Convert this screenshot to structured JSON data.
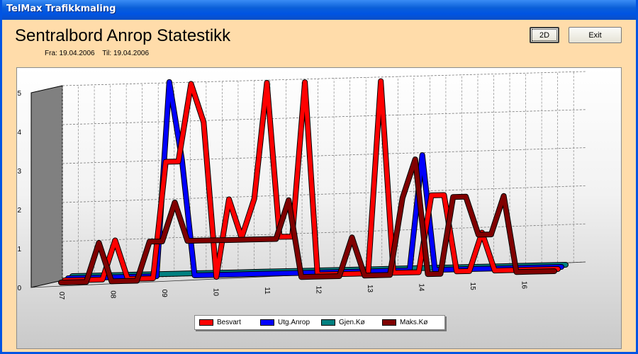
{
  "window": {
    "title": "TelMax Trafikkmaling"
  },
  "header": {
    "title": "Sentralbord Anrop Statestikk",
    "from_label": "Fra: 19.04.2006",
    "to_label": "Til: 19.04.2006"
  },
  "buttons": {
    "mode_label": "2D",
    "exit_label": "Exit"
  },
  "chart_data": {
    "type": "line",
    "title": "",
    "xlabel": "",
    "ylabel": "",
    "ylim": [
      0,
      5
    ],
    "y_ticks": [
      "0",
      "1",
      "2",
      "3",
      "4",
      "5"
    ],
    "x_ticks": [
      "07",
      "08",
      "09",
      "10",
      "11",
      "12",
      "13",
      "14",
      "15",
      "16"
    ],
    "grid": true,
    "legend_position": "bottom",
    "series": [
      {
        "name": "Besvart",
        "color": "#ff0000",
        "values": [
          0,
          0,
          0,
          0,
          1,
          0,
          0,
          0,
          3,
          3,
          5,
          4,
          0,
          2,
          1,
          2,
          5,
          1,
          1,
          5,
          0,
          0,
          0,
          0,
          0,
          5,
          0,
          0,
          0,
          2,
          2,
          0,
          0,
          1,
          0,
          0,
          0,
          0,
          0,
          0
        ]
      },
      {
        "name": "Utg.Anrop",
        "color": "#0000ff",
        "values": [
          0,
          0,
          0,
          0,
          0,
          0,
          0,
          0,
          5,
          3,
          0,
          0,
          0,
          0,
          0,
          0,
          0,
          0,
          0,
          0,
          0,
          0,
          0,
          0,
          0,
          0,
          0,
          0,
          3,
          0,
          0,
          0,
          0,
          0,
          0,
          0,
          0,
          0,
          0,
          0
        ]
      },
      {
        "name": "Gjen.Kø",
        "color": "#008080",
        "values": [
          0,
          0,
          0,
          0,
          0,
          0,
          0,
          0,
          0,
          0,
          0,
          0,
          0,
          0,
          0,
          0,
          0,
          0,
          0,
          0,
          0,
          0,
          0,
          0,
          0,
          0,
          0,
          0,
          0,
          0,
          0,
          0,
          0,
          0,
          0,
          0,
          0,
          0,
          0,
          0
        ]
      },
      {
        "name": "Maks.Kø",
        "color": "#800000",
        "values": [
          0,
          0,
          0,
          1,
          0,
          0,
          0,
          1,
          1,
          2,
          1,
          1,
          1,
          1,
          1,
          1,
          1,
          1,
          2,
          0,
          0,
          0,
          0,
          1,
          0,
          0,
          0,
          2,
          3,
          0,
          0,
          2,
          2,
          1,
          1,
          2,
          0,
          0,
          0,
          0
        ]
      }
    ]
  }
}
